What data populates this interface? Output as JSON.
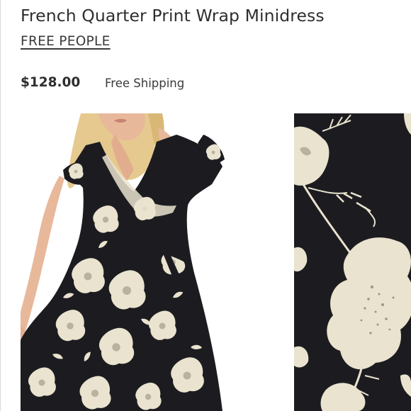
{
  "product": {
    "title": "French Quarter Print Wrap Minidress",
    "brand": "FREE PEOPLE",
    "price": "$128.00",
    "shipping": "Free Shipping"
  },
  "colors": {
    "text": "#2e2e2e",
    "dress_black": "#1c1c20",
    "flower_cream": "#e9e3cf",
    "hair_blonde": "#e6c98e",
    "skin": "#e8b89a"
  }
}
